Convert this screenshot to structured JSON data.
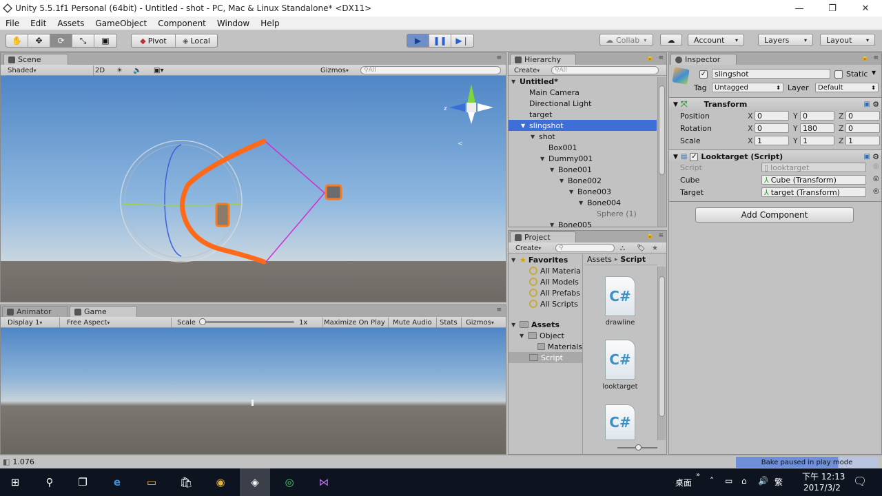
{
  "window": {
    "title": "Unity 5.5.1f1 Personal (64bit) - Untitled - shot - PC, Mac & Linux Standalone* <DX11>",
    "min": "—",
    "max": "❐",
    "close": "✕"
  },
  "menu": [
    "File",
    "Edit",
    "Assets",
    "GameObject",
    "Component",
    "Window",
    "Help"
  ],
  "toolbar": {
    "tool_icons": [
      "hand-icon",
      "move-icon",
      "rotate-icon",
      "scale-icon",
      "rect-icon"
    ],
    "pivot": "Pivot",
    "local": "Local",
    "collab": "Collab",
    "account": "Account",
    "layers": "Layers",
    "layout": "Layout"
  },
  "scene": {
    "tab": "Scene",
    "shaded": "Shaded",
    "mode_2d": "2D",
    "gizmos": "Gizmos",
    "search_placeholder": "All"
  },
  "game": {
    "tab_animator": "Animator",
    "tab_game": "Game",
    "display": "Display 1",
    "aspect": "Free Aspect",
    "scale_label": "Scale",
    "scale_value": 0.0,
    "scale_text": "1x",
    "maximize": "Maximize On Play",
    "mute": "Mute Audio",
    "stats": "Stats",
    "gizmos": "Gizmos"
  },
  "hierarchy": {
    "tab": "Hierarchy",
    "create": "Create",
    "search_placeholder": "All",
    "rows": [
      {
        "label": "Untitled*",
        "depth": 0,
        "arrow": "▼",
        "bold": true
      },
      {
        "label": "Main Camera",
        "depth": 1,
        "arrow": ""
      },
      {
        "label": "Directional Light",
        "depth": 1,
        "arrow": ""
      },
      {
        "label": "target",
        "depth": 1,
        "arrow": ""
      },
      {
        "label": "slingshot",
        "depth": 1,
        "arrow": "▼",
        "selected": true
      },
      {
        "label": "shot",
        "depth": 2,
        "arrow": "▼"
      },
      {
        "label": "Box001",
        "depth": 3,
        "arrow": ""
      },
      {
        "label": "Dummy001",
        "depth": 3,
        "arrow": "▼"
      },
      {
        "label": "Bone001",
        "depth": 4,
        "arrow": "▼"
      },
      {
        "label": "Bone002",
        "depth": 5,
        "arrow": "▼"
      },
      {
        "label": "Bone003",
        "depth": 6,
        "arrow": "▼"
      },
      {
        "label": "Bone004",
        "depth": 7,
        "arrow": "▼"
      },
      {
        "label": "Sphere (1)",
        "depth": 8,
        "arrow": "",
        "grey": true
      },
      {
        "label": "Bone005",
        "depth": 4,
        "arrow": "▼"
      }
    ]
  },
  "project": {
    "tab": "Project",
    "create": "Create",
    "favorites": "Favorites",
    "fav_items": [
      "All Materia",
      "All Models",
      "All Prefabs",
      "All Scripts"
    ],
    "assets": "Assets",
    "object": "Object",
    "materials": "Materials",
    "script": "Script",
    "breadcrumb_assets": "Assets",
    "breadcrumb_sep": "▸",
    "breadcrumb_script": "Script",
    "files": [
      "drawline",
      "looktarget",
      ""
    ],
    "cs_glyph": "C#"
  },
  "inspector": {
    "tab": "Inspector",
    "object_name": "slingshot",
    "static": "Static",
    "tag_label": "Tag",
    "tag_value": "Untagged",
    "layer_label": "Layer",
    "layer_value": "Default",
    "transform": {
      "title": "Transform",
      "position_label": "Position",
      "rotation_label": "Rotation",
      "scale_label": "Scale",
      "position": [
        "0",
        "0",
        "0"
      ],
      "rotation": [
        "0",
        "180",
        "0"
      ],
      "scale": [
        "1",
        "1",
        "1"
      ],
      "axis": [
        "X",
        "Y",
        "Z"
      ]
    },
    "script_comp": {
      "title": "Looktarget (Script)",
      "script_label": "Script",
      "script_value": "looktarget",
      "cube_label": "Cube",
      "cube_value": "Cube (Transform)",
      "target_label": "Target",
      "target_value": "target (Transform)"
    },
    "add_component": "Add Component"
  },
  "status": {
    "left": "1.076",
    "right": "Bake paused in play mode"
  },
  "taskbar": {
    "desktop": "桌面",
    "ime": "繁",
    "time": "下午 12:13",
    "date": "2017/3/2"
  }
}
